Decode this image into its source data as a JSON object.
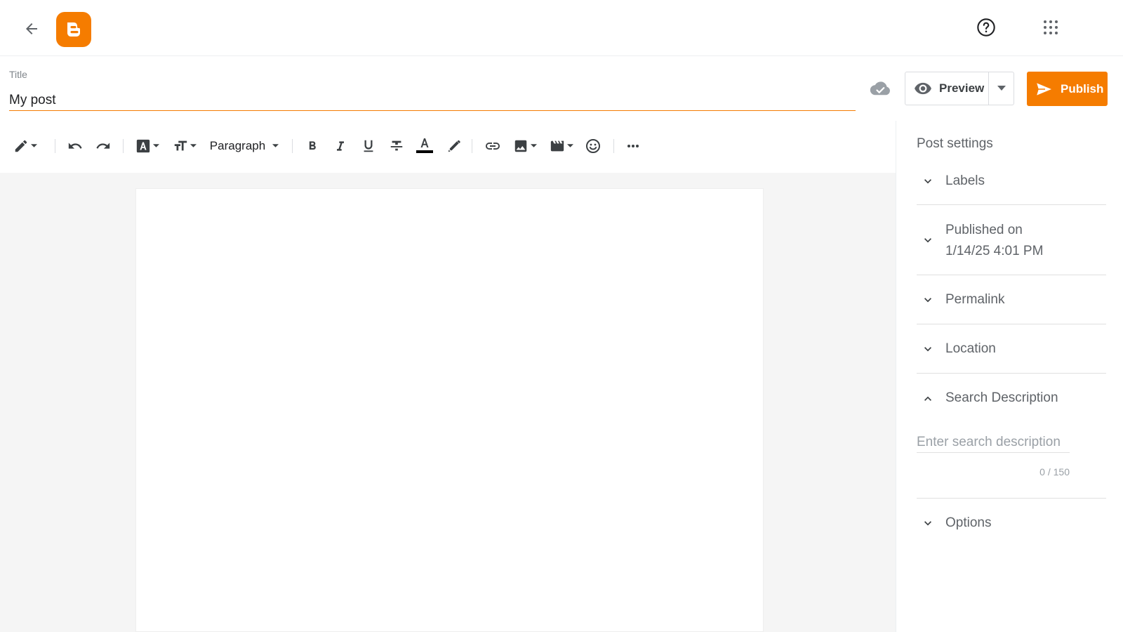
{
  "header": {
    "back_icon": "arrow-left-icon",
    "logo_icon": "blogger-logo-icon",
    "help_icon": "help-circle-icon",
    "apps_icon": "apps-grid-icon"
  },
  "post": {
    "title_label": "Title",
    "title_value": "My post"
  },
  "actions": {
    "saved_icon": "cloud-check-icon",
    "preview_label": "Preview",
    "publish_label": "Publish",
    "accent_color": "#f57c00"
  },
  "toolbar": {
    "paragraph_label": "Paragraph",
    "text_color_underline": "#000000"
  },
  "settings": {
    "title": "Post settings",
    "labels": "Labels",
    "published_line1": "Published on",
    "published_line2": "1/14/25 4:01 PM",
    "permalink": "Permalink",
    "location": "Location",
    "search_description": "Search Description",
    "search_description_placeholder": "Enter search description",
    "search_description_value": "",
    "search_description_count": "0 / 150",
    "options": "Options"
  }
}
